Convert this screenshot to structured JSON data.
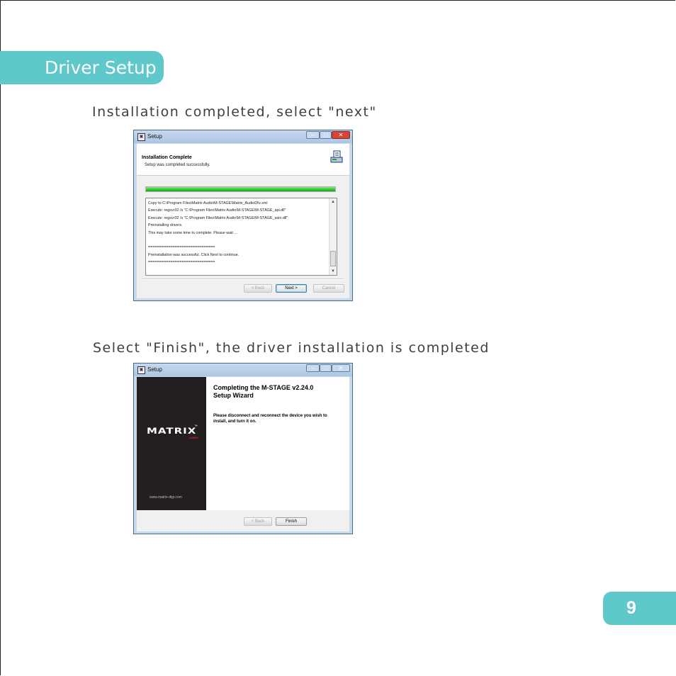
{
  "section_title": "Driver Setup",
  "page_number": "9",
  "step1": {
    "instruction": "Installation completed, select \"next\"",
    "window": {
      "title": "Setup",
      "header_title": "Installation Complete",
      "header_subtitle": "Setup was completed successfully.",
      "progress_fraction": 1.0,
      "log_lines": [
        "Copy to C:\\Program Files\\Matrix Audio\\M-STAGE\\Matrix_AudioDfu.xml",
        "Execute: regsvr32 /s \"C:\\Program Files\\Matrix Audio\\M-STAGE\\M-STAGE_api.dll\"",
        "Execute: regsvr32 /s \"C:\\Program Files\\Matrix Audio\\M-STAGE\\M-STAGE_asio.dll\"",
        "Preinstalling drivers.",
        "This may take some time to complete. Please wait ...",
        "",
        "==============================",
        "Preinstallation was successful. Click Next to continue.",
        "=============================="
      ],
      "buttons": {
        "back": "< Back",
        "next": "Next >",
        "cancel": "Cancel"
      }
    }
  },
  "step2": {
    "instruction": "Select \"Finish\", the driver installation is completed",
    "window": {
      "title": "Setup",
      "brand": "MATRIX",
      "brand_tm": "™",
      "brand_sub": "AUDIO",
      "website": "www.matrix-digi.com",
      "heading_line1": "Completing the M-STAGE v2.24.0",
      "heading_line2": "Setup Wizard",
      "body": "Please disconnect and reconnect the device you wish to install, and turn it on.",
      "buttons": {
        "back": "< Back",
        "finish": "Finish"
      }
    }
  },
  "colors": {
    "accent": "#5ec8cb",
    "progress": "#2ec42e"
  }
}
